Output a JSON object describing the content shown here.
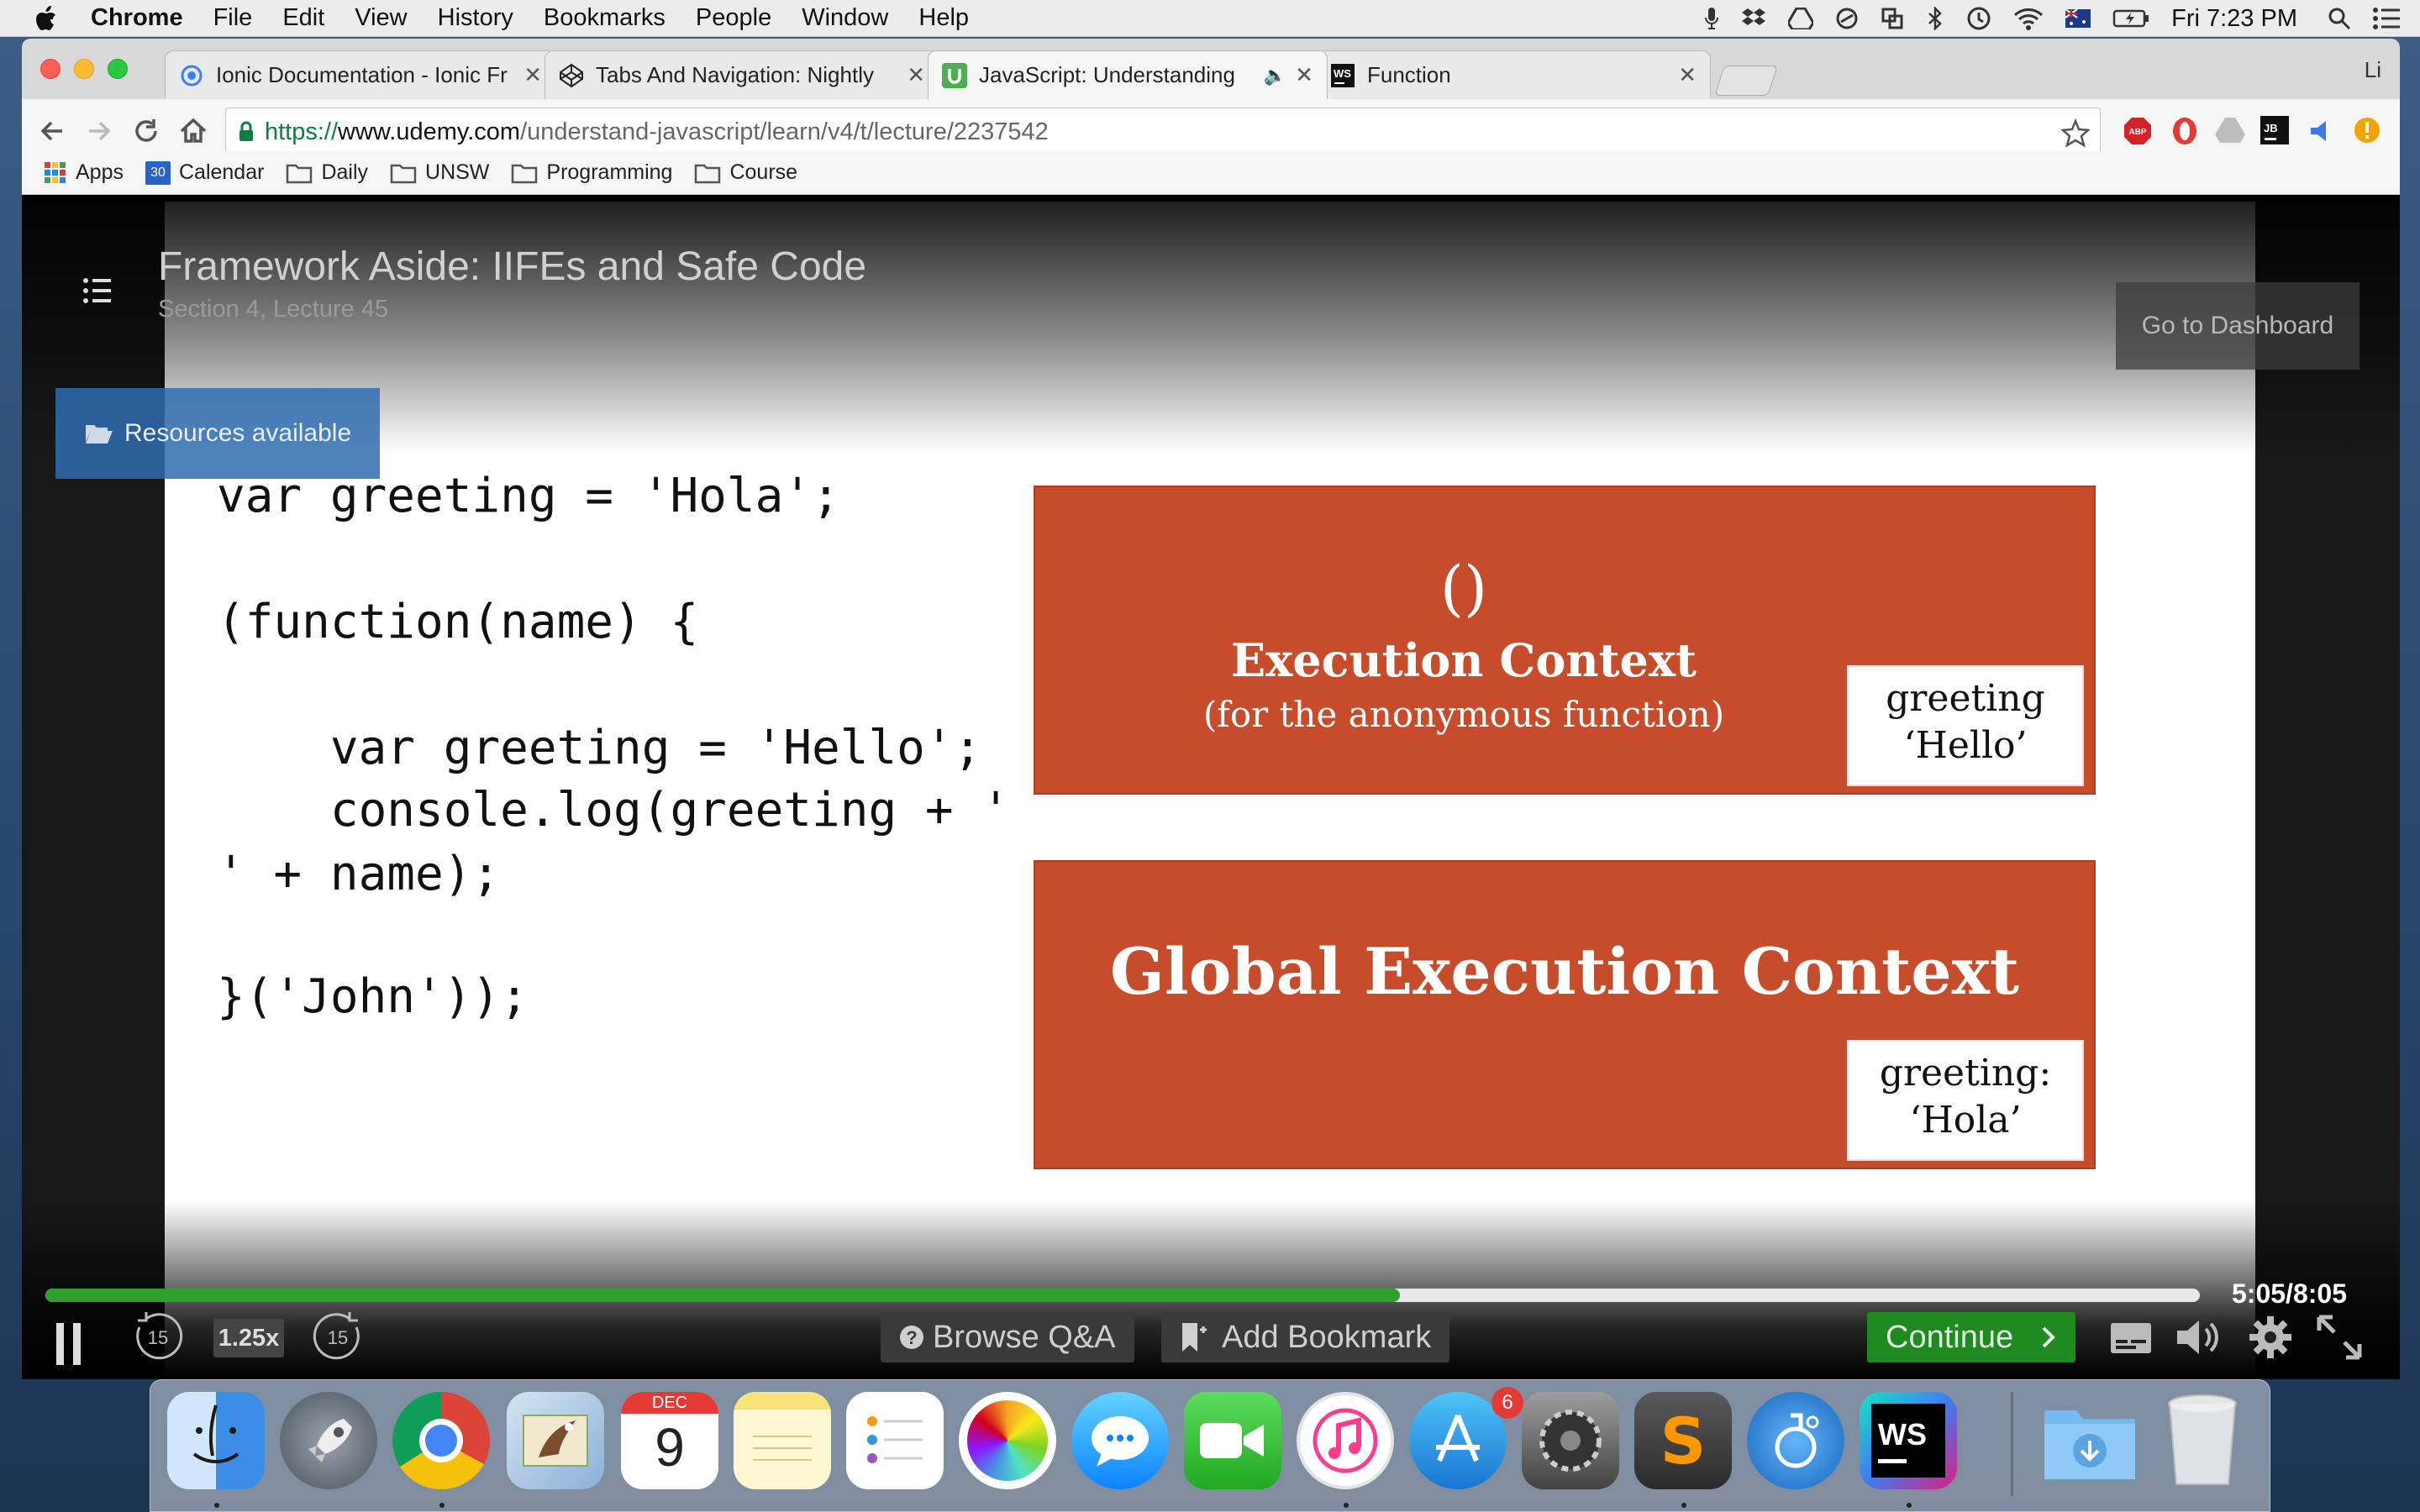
{
  "menubar": {
    "app_name": "Chrome",
    "items": [
      "File",
      "Edit",
      "View",
      "History",
      "Bookmarks",
      "People",
      "Window",
      "Help"
    ],
    "clock": "Fri 7:23 PM"
  },
  "browser": {
    "profile_initial": "Li",
    "tabs": [
      {
        "title": "Ionic Documentation - Ionic Fr",
        "favicon": "ionic-icon"
      },
      {
        "title": "Tabs And Navigation: Nightly",
        "favicon": "codepen-icon"
      },
      {
        "title": "JavaScript: Understanding",
        "favicon": "udemy-icon",
        "audio": true
      },
      {
        "title": "Function",
        "favicon": "webstorm-icon"
      }
    ],
    "url": {
      "scheme": "https://",
      "host": "www.udemy.com",
      "path": "/understand-javascript/learn/v4/t/lecture/2237542"
    },
    "bookmarks": [
      {
        "label": "Apps",
        "icon": "apps-grid-icon"
      },
      {
        "label": "Calendar",
        "icon": "calendar-icon",
        "badge": "30"
      },
      {
        "label": "Daily",
        "icon": "folder-icon"
      },
      {
        "label": "UNSW",
        "icon": "folder-icon"
      },
      {
        "label": "Programming",
        "icon": "folder-icon"
      },
      {
        "label": "Course",
        "icon": "folder-icon"
      }
    ],
    "extensions": [
      "abp-icon",
      "opera-icon",
      "drive-icon",
      "jetbrains-icon",
      "cast-icon",
      "warning-icon"
    ],
    "extension_labels": {
      "abp": "ABP",
      "jetbrains": "JB"
    }
  },
  "player": {
    "lecture_title": "Framework Aside: IIFEs and Safe Code",
    "lecture_subtitle": "Section 4, Lecture 45",
    "dashboard_button": "Go to Dashboard",
    "resources_button": "Resources available",
    "slide": {
      "code_lines": [
        "var greeting = 'Hola';",
        "(function(name) {",
        "    var greeting = 'Hello';",
        "    console.log(greeting + '",
        "' + name);",
        "}('John'));"
      ],
      "inner_context": {
        "symbol": "()",
        "title": "Execution Context",
        "subtitle": "(for the anonymous function)",
        "var_name": "greeting",
        "var_value": "‘Hello’"
      },
      "global_context": {
        "title": "Global Execution Context",
        "var_name": "greeting:",
        "var_value": "‘Hola’"
      }
    },
    "controls": {
      "time_display": "5:05/8:05",
      "progress_fraction": 0.6289,
      "speed": "1.25x",
      "rewind_seconds": "15",
      "forward_seconds": "15",
      "browse_qa": "Browse Q&A",
      "add_bookmark": "Add Bookmark",
      "continue": "Continue"
    }
  },
  "dock": {
    "apps": [
      "finder-icon",
      "launchpad-icon",
      "chrome-icon",
      "mail-icon",
      "calendar-icon",
      "notes-icon",
      "reminders-icon",
      "photos-icon",
      "messages-icon",
      "facetime-icon",
      "itunes-icon",
      "app-store-icon",
      "system-preferences-icon",
      "sublime-text-icon",
      "chemistry-app-icon",
      "webstorm-icon",
      "downloads-folder-icon",
      "trash-icon"
    ],
    "calendar_month": "DEC",
    "calendar_day": "9",
    "app_store_badge": "6",
    "webstorm_label": "WS",
    "sublime_label": "S"
  },
  "colors": {
    "progress": "#2ea02e",
    "slide_box": "#c64c2b",
    "continue_button": "#1f8a1f",
    "resources_button": "#2e6cb0"
  }
}
